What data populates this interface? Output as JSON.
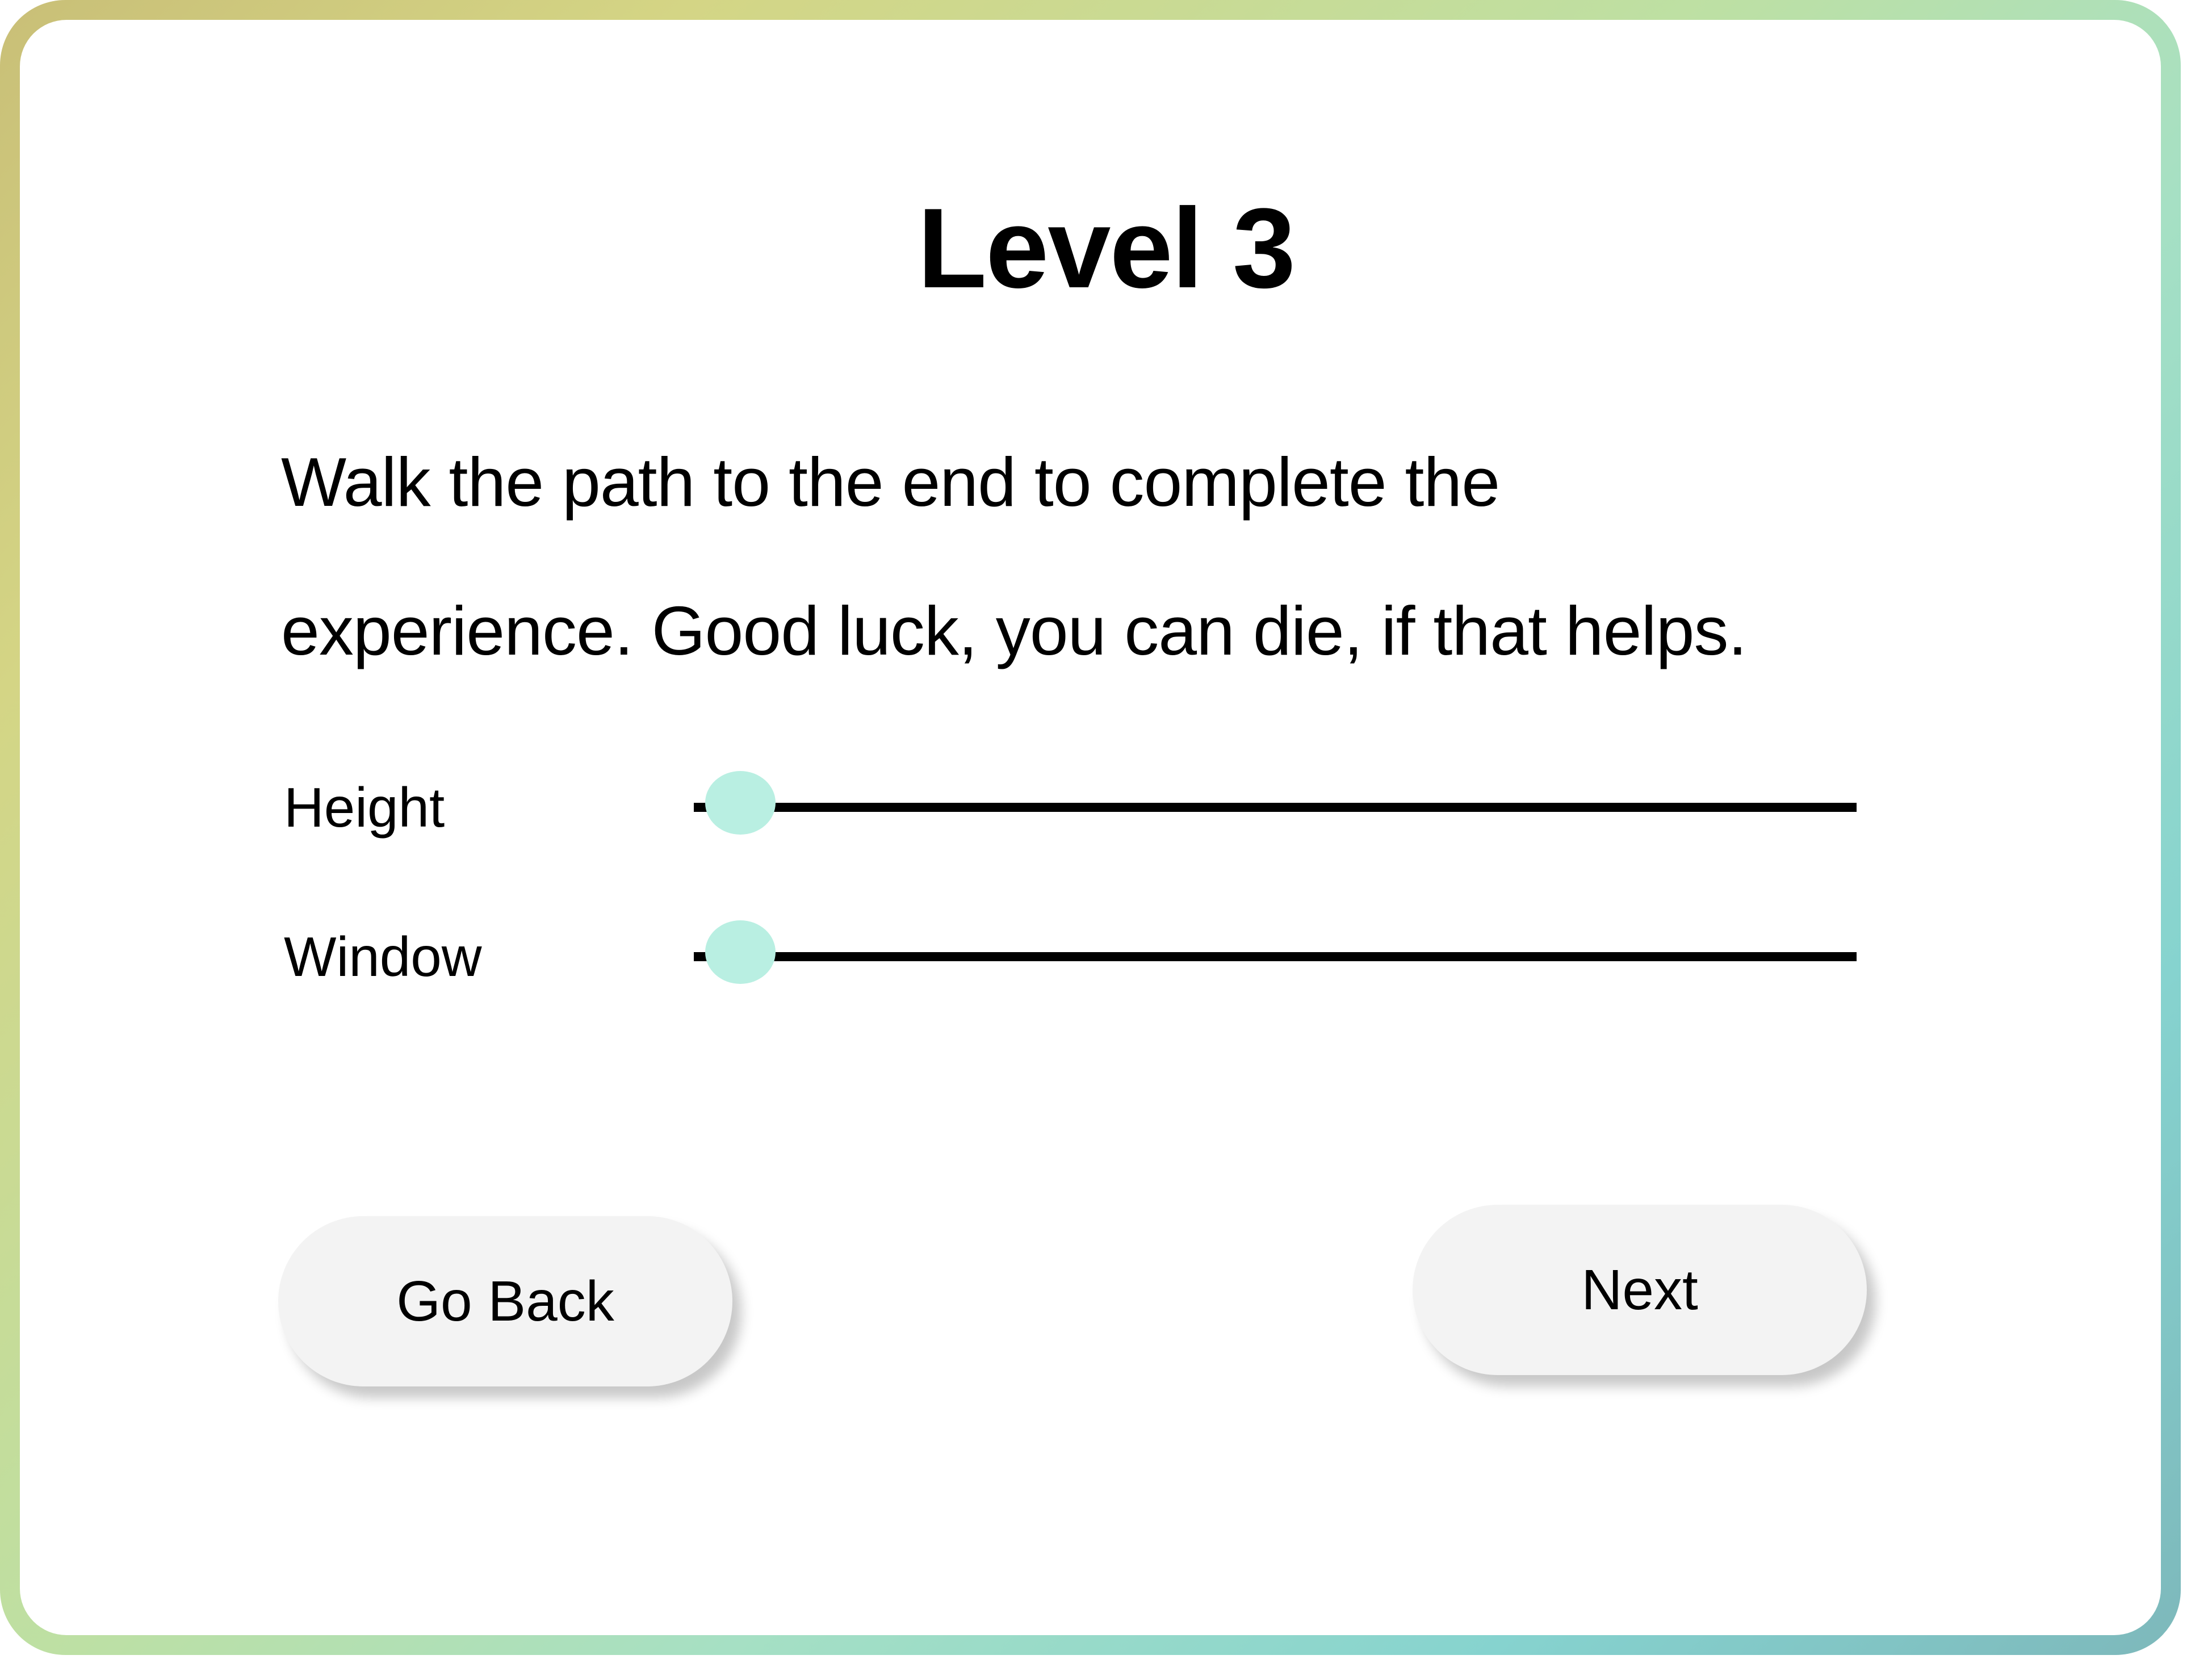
{
  "level": {
    "title": "Level 3"
  },
  "description": {
    "lines": [
      "Walk the path to the end to complete the",
      "experience. Good luck, you can die, if that helps."
    ]
  },
  "sliders": [
    {
      "label": "Height",
      "value_fraction": 0.04,
      "thumb_color": "#b9efe2"
    },
    {
      "label": "Window",
      "value_fraction": 0.04,
      "thumb_color": "#b9efe2"
    }
  ],
  "buttons": {
    "back_label": "Go Back",
    "next_label": "Next"
  },
  "colors": {
    "frame_gradient": [
      "#c9bf77",
      "#d4d585",
      "#bde0a4",
      "#a6e0c4",
      "#86d3cf",
      "#7db8bb"
    ],
    "button_bg": "#f3f3f3",
    "track": "#000000"
  }
}
